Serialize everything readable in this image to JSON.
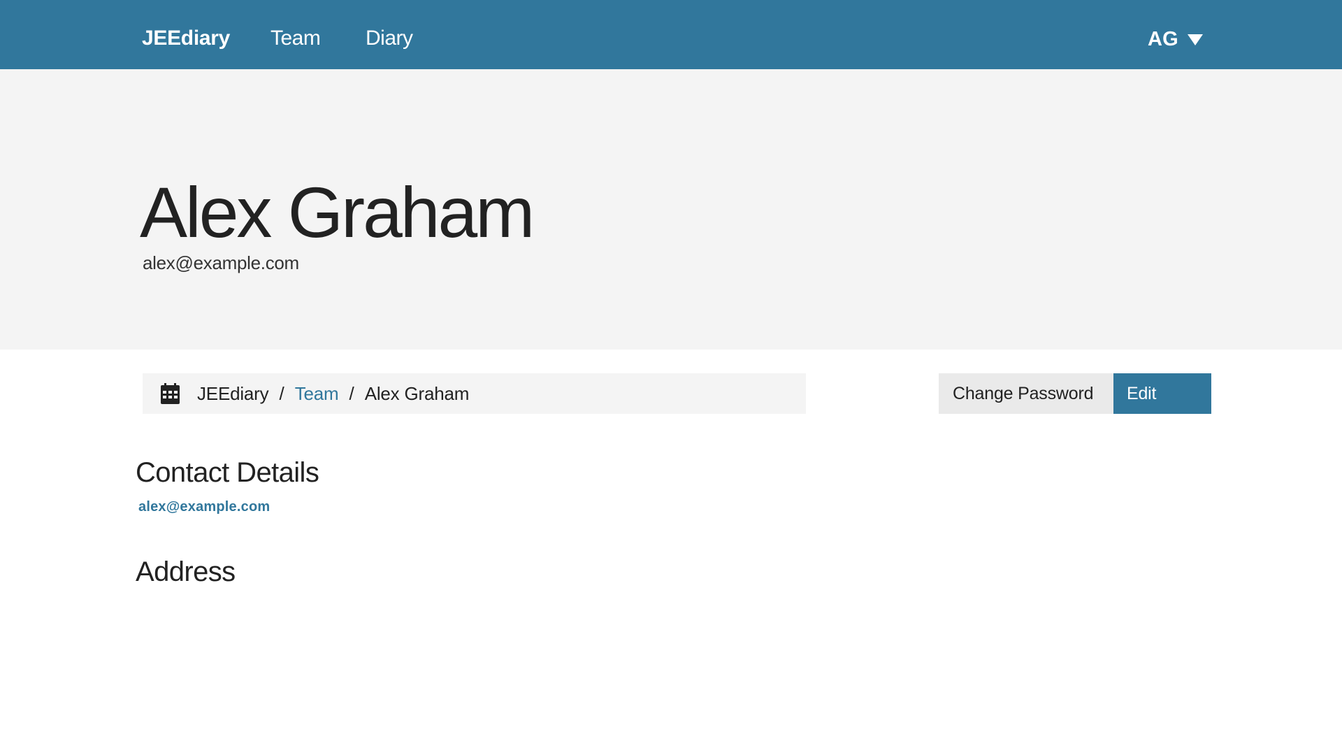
{
  "navbar": {
    "brand": "JEEdiary",
    "links": [
      "Team",
      "Diary"
    ],
    "user_initials": "AG",
    "user_menu_icon": "caret-down-icon",
    "background_color": "#31779c"
  },
  "hero": {
    "name": "Alex Graham",
    "email": "alex@example.com",
    "background_color": "#f4f4f4"
  },
  "breadcrumb": {
    "icon": "calendar-icon",
    "items": [
      {
        "label": "JEEdiary",
        "link": false
      },
      {
        "label": "Team",
        "link": true
      },
      {
        "label": "Alex Graham",
        "link": false
      }
    ],
    "separator": "/"
  },
  "actions": {
    "change_password_label": "Change Password",
    "edit_label": "Edit"
  },
  "contact_details": {
    "heading": "Contact Details",
    "email": "alex@example.com"
  },
  "address": {
    "heading": "Address"
  },
  "colors": {
    "accent": "#31779c",
    "panel": "#f4f4f4",
    "button_secondary": "#eaeaea"
  }
}
